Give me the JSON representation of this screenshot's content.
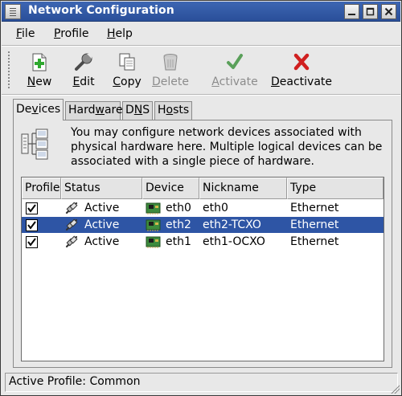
{
  "window": {
    "title": "Network Configuration"
  },
  "menu": [
    {
      "pre": "",
      "key": "F",
      "post": "ile"
    },
    {
      "pre": "",
      "key": "P",
      "post": "rofile"
    },
    {
      "pre": "",
      "key": "H",
      "post": "elp"
    }
  ],
  "toolbar": {
    "new": {
      "pre": "",
      "key": "N",
      "post": "ew",
      "icon": "new-icon",
      "enabled": true
    },
    "edit": {
      "pre": "",
      "key": "E",
      "post": "dit",
      "icon": "wrench-icon",
      "enabled": true
    },
    "copy": {
      "pre": "",
      "key": "C",
      "post": "opy",
      "icon": "copy-icon",
      "enabled": true
    },
    "delete": {
      "pre": "",
      "key": "D",
      "post": "elete",
      "icon": "trash-icon",
      "enabled": false
    },
    "activate": {
      "pre": "",
      "key": "A",
      "post": "ctivate",
      "icon": "check-icon",
      "enabled": false
    },
    "deactivate": {
      "pre": "",
      "key": "D",
      "post": "eactivate",
      "icon": "x-icon",
      "enabled": true
    }
  },
  "tabs": [
    {
      "pre": "De",
      "key": "v",
      "post": "ices",
      "active": true
    },
    {
      "pre": "Hard",
      "key": "w",
      "post": "are",
      "active": false
    },
    {
      "pre": "D",
      "key": "N",
      "post": "S",
      "active": false
    },
    {
      "pre": "H",
      "key": "o",
      "post": "sts",
      "active": false
    }
  ],
  "devices_panel": {
    "description": "You may configure network devices associated with physical hardware here.  Multiple logical devices can be associated with a single piece of hardware.",
    "columns": [
      "Profile",
      "Status",
      "Device",
      "Nickname",
      "Type"
    ],
    "rows": [
      {
        "profile_checked": true,
        "status": "Active",
        "device": "eth0",
        "nickname": "eth0",
        "type": "Ethernet",
        "selected": false
      },
      {
        "profile_checked": true,
        "status": "Active",
        "device": "eth2",
        "nickname": "eth2-TCXO",
        "type": "Ethernet",
        "selected": true
      },
      {
        "profile_checked": true,
        "status": "Active",
        "device": "eth1",
        "nickname": "eth1-OCXO",
        "type": "Ethernet",
        "selected": false
      }
    ]
  },
  "statusbar": {
    "text": "Active Profile: Common"
  },
  "colors": {
    "titlebar": "#2f58a6",
    "selection": "#2e55a5",
    "new_icon": "#2fa82f",
    "activate_icon": "#5aa05a",
    "deactivate_icon": "#d02020"
  }
}
